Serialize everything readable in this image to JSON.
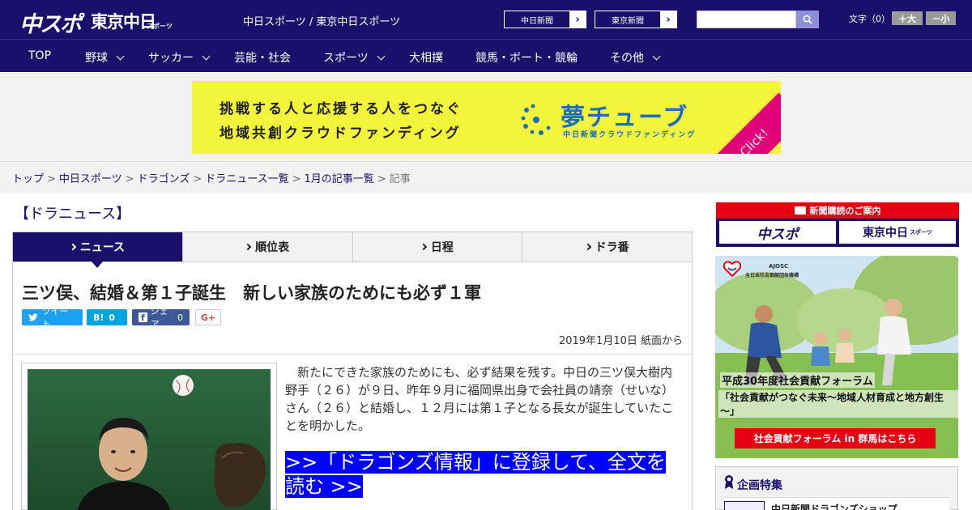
{
  "header": {
    "logo_main": "中スポ",
    "logo_tokyo": "東京中日",
    "logo_tokyo_sub": "スポーツ",
    "site_links": "中日スポーツ / 東京中日スポーツ",
    "paper_buttons": [
      "中日新聞",
      "東京新聞"
    ],
    "search_placeholder": "",
    "font_size_label": "文字（0）",
    "font_larger": "＋大",
    "font_smaller": "－小"
  },
  "nav": {
    "items": [
      {
        "label": "TOP",
        "has_dropdown": false
      },
      {
        "label": "野球",
        "has_dropdown": true
      },
      {
        "label": "サッカー",
        "has_dropdown": true
      },
      {
        "label": "芸能・社会",
        "has_dropdown": false
      },
      {
        "label": "スポーツ",
        "has_dropdown": true
      },
      {
        "label": "大相撲",
        "has_dropdown": false
      },
      {
        "label": "競馬・ボート・競輪",
        "has_dropdown": false
      },
      {
        "label": "その他",
        "has_dropdown": true
      }
    ]
  },
  "banner": {
    "line1": "挑戦する人と応援する人をつなぐ",
    "line2": "地域共創クラウドファンディング",
    "brand": "夢チューブ",
    "brand_sub": "中日新聞クラウドファンディング",
    "click": "Click!",
    "bg_color": "#f3f53a"
  },
  "breadcrumb": {
    "items": [
      "トップ",
      "中日スポーツ",
      "ドラゴンズ",
      "ドラニュース一覧",
      "1月の記事一覧"
    ],
    "current": "記事",
    "separator": ">"
  },
  "section_title": "【ドラニュース】",
  "tabs": [
    {
      "label": "ニュース",
      "active": true
    },
    {
      "label": "順位表",
      "active": false
    },
    {
      "label": "日程",
      "active": false
    },
    {
      "label": "ドラ番",
      "active": false
    }
  ],
  "article": {
    "headline": "三ツ俣、結婚＆第１子誕生　新しい家族のためにも必ず１軍",
    "share": {
      "tweet": "ツイート",
      "hatena": "B!",
      "hatena_count": "0",
      "fb": "シェア",
      "fb_count": "0",
      "gplus": "G+"
    },
    "date": "2019年1月10日 紙面から",
    "body": "新たにできた家族のためにも、必ず結果を残す。中日の三ツ俣大樹内野手（２６）が９日、昨年９月に福岡県出身で会社員の靖奈（せいな）さん（２６）と結婚し、１２月には第１子となる長女が誕生していたことを明かした。",
    "cta": ">>「ドラゴンズ情報」に登録して、全文を読む >>"
  },
  "sidebar": {
    "subscribe_title": "新聞購読のご案内",
    "subscribe_logos": [
      "中スポ",
      "東京中日"
    ],
    "subscribe_logo_sub": "スポーツ",
    "ad_org_en": "AJOSC",
    "ad_org": "全日本社会貢献団体機構",
    "ad_line1": "平成30年度社会貢献フォーラム",
    "ad_line2": "「社会貢献がつなぐ未来～地域人材育成と地方創生～」",
    "ad_button": "社会貢献フォーラム in 群馬はこちら",
    "feature_title": "企画特集",
    "feature_item": "中日新聞ドラゴンズショップ"
  },
  "colors": {
    "brand_navy": "#1a0f6b",
    "cta_blue": "#0000ff",
    "twitter": "#1da1f2",
    "hatena": "#00a4de",
    "facebook": "#3b5998",
    "sub_red": "#e50012"
  }
}
